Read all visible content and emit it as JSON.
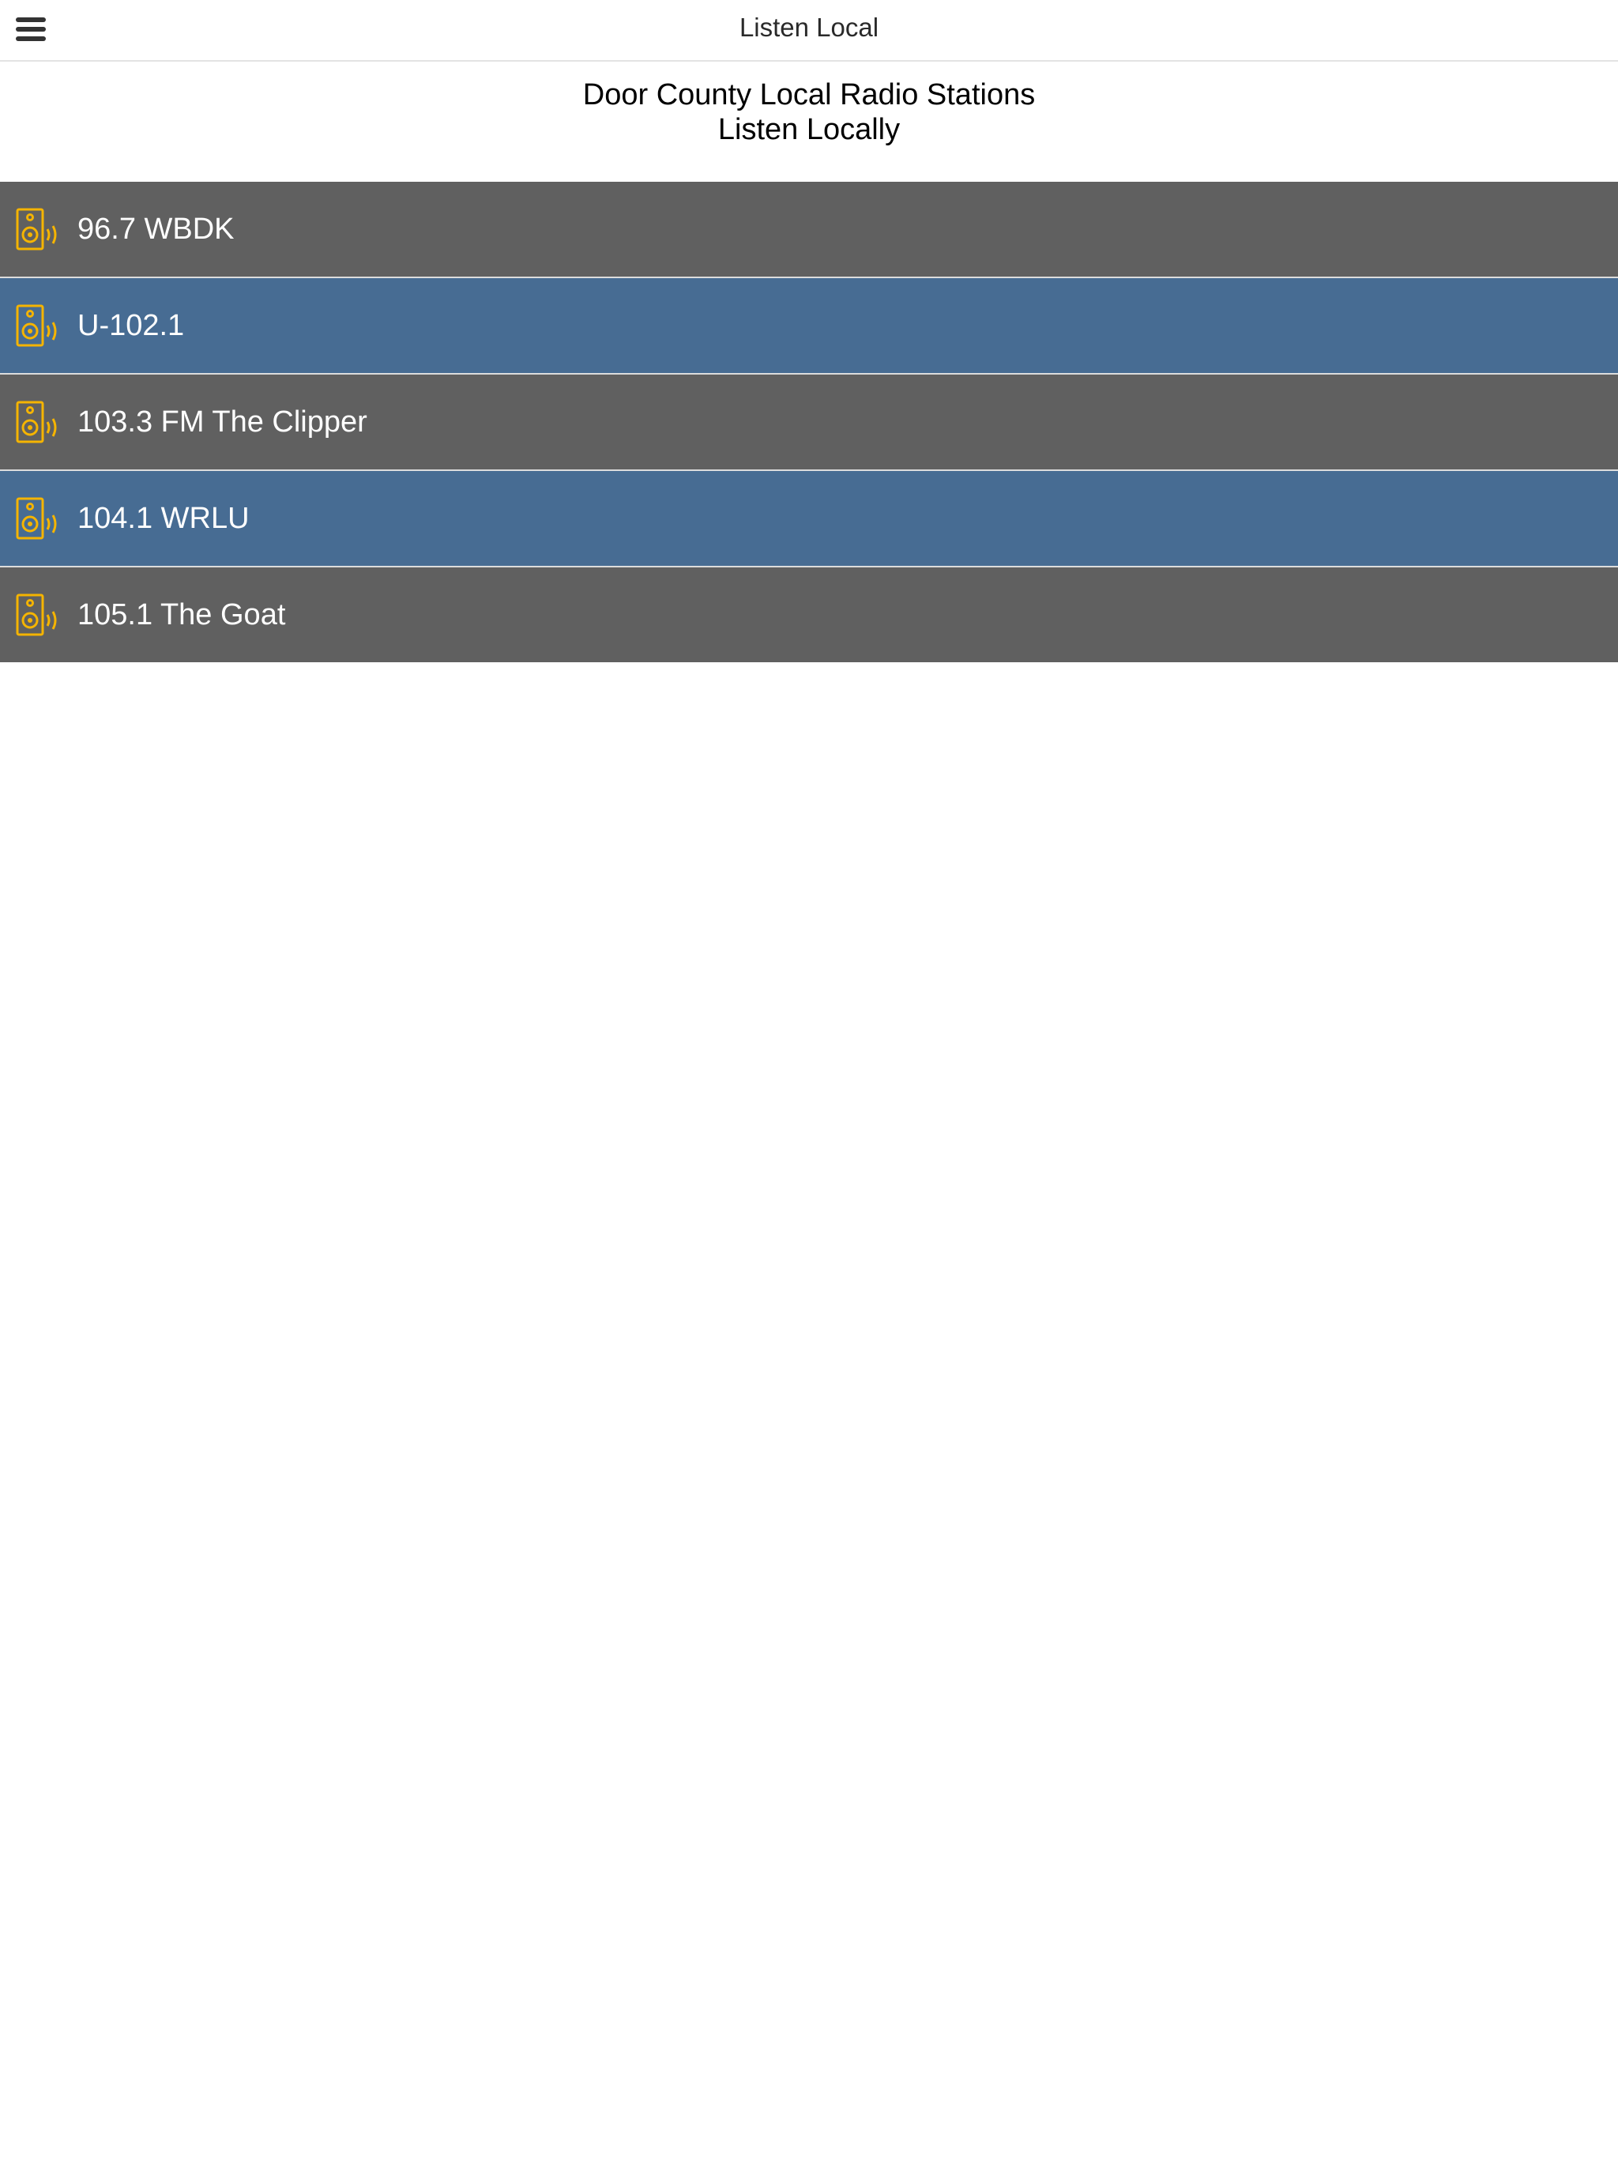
{
  "navbar": {
    "title": "Listen Local",
    "menu_icon": "hamburger-menu-icon"
  },
  "header": {
    "line1": "Door County Local Radio Stations",
    "line2": "Listen Locally"
  },
  "colors": {
    "row_gray": "#606060",
    "row_blue": "#476c93",
    "icon_accent": "#f5b400"
  },
  "stations": [
    {
      "name": "96.7 WBDK",
      "icon": "speaker-icon",
      "color": "gray"
    },
    {
      "name": "U-102.1",
      "icon": "speaker-icon",
      "color": "blue"
    },
    {
      "name": "103.3 FM The Clipper",
      "icon": "speaker-icon",
      "color": "gray"
    },
    {
      "name": "104.1 WRLU",
      "icon": "speaker-icon",
      "color": "blue"
    },
    {
      "name": "105.1 The Goat",
      "icon": "speaker-icon",
      "color": "gray"
    }
  ]
}
